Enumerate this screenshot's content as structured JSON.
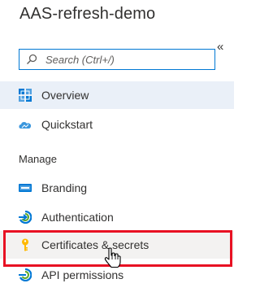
{
  "app": {
    "title": "AAS-refresh-demo"
  },
  "search": {
    "placeholder": "Search (Ctrl+/)"
  },
  "sidebar": {
    "collapse_label": "«",
    "items": [
      {
        "label": "Overview",
        "icon": "grid-icon",
        "selected": true
      },
      {
        "label": "Quickstart",
        "icon": "cloud-icon"
      }
    ],
    "section_manage": "Manage",
    "manage_items": [
      {
        "label": "Branding",
        "icon": "branding-icon"
      },
      {
        "label": "Authentication",
        "icon": "authentication-icon"
      },
      {
        "label": "Certificates & secrets",
        "icon": "key-icon",
        "hovered": true
      },
      {
        "label": "API permissions",
        "icon": "api-permissions-icon"
      }
    ]
  },
  "colors": {
    "accent": "#0078d4",
    "highlight_border": "#e81123",
    "key": "#ffb900"
  }
}
